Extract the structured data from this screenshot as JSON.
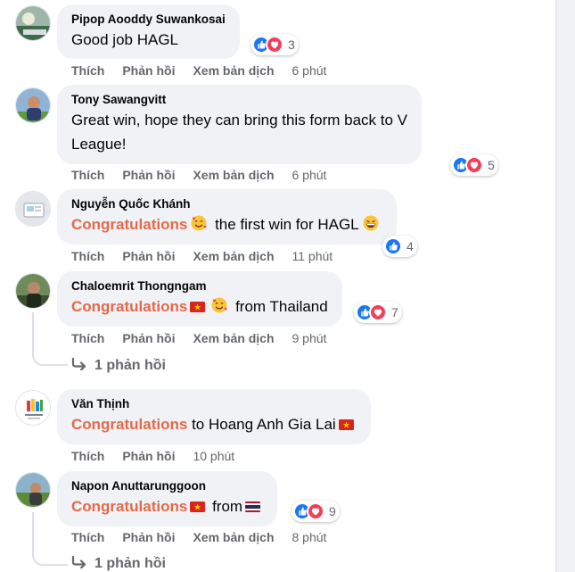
{
  "actions": {
    "like": "Thích",
    "reply": "Phản hồi",
    "translate": "Xem bản dịch"
  },
  "comments": [
    {
      "author": "Pipop Aooddy Suwankosai",
      "text": "Good job HAGL",
      "reactions": "3",
      "time": "6 phút"
    },
    {
      "author": "Tony Sawangvitt",
      "text_line1": "Great win, hope they can bring this form back to V",
      "text_line2": "League!",
      "reactions": "5",
      "time": "6 phút"
    },
    {
      "author": "Nguyễn Quốc Khánh",
      "highlight": "Congratulations",
      "text": "the first win for HAGL",
      "reactions": "4",
      "time": "11 phút"
    },
    {
      "author": "Chaloemrit Thongngam",
      "highlight": "Congratulations",
      "text": "from Thailand",
      "reactions": "7",
      "time": "9 phút",
      "replies": "1 phản hồi"
    },
    {
      "author": "Văn Thịnh",
      "highlight": "Congratulations",
      "text": "to Hoang Anh Gia Lai",
      "time": "10 phút"
    },
    {
      "author": "Napon Anuttarunggoon",
      "highlight": "Congratulations",
      "text": "from",
      "reactions": "9",
      "time": "8 phút",
      "replies": "1 phản hồi"
    }
  ],
  "icons": {
    "like": "thumbs-up-icon",
    "love": "heart-icon",
    "reply_arrow": "reply-arrow-icon",
    "vn_flag": "vietnam-flag-icon",
    "th_flag": "thailand-flag-icon",
    "love_face": "smiling-face-with-hearts-icon",
    "grin": "grinning-face-icon"
  },
  "colors": {
    "highlight": "#e4694a",
    "like": "#1877f2",
    "love": "#f33e58",
    "bubble": "#f0f2f5",
    "muted": "#65676b"
  }
}
